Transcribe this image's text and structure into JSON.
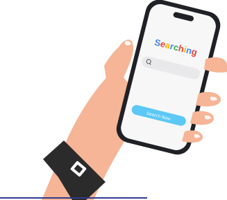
{
  "phone": {
    "title_letters": [
      {
        "char": "S",
        "color": "#4285F4"
      },
      {
        "char": "e",
        "color": "#EA4335"
      },
      {
        "char": "a",
        "color": "#FBBC05"
      },
      {
        "char": "r",
        "color": "#4285F4"
      },
      {
        "char": "c",
        "color": "#34A853"
      },
      {
        "char": "h",
        "color": "#EA4335"
      },
      {
        "char": "i",
        "color": "#FBBC05"
      },
      {
        "char": "n",
        "color": "#4285F4"
      },
      {
        "char": "g",
        "color": "#EA4335"
      }
    ],
    "search_button_label": "Search Now",
    "search_icon": "search-icon"
  },
  "colors": {
    "skin": "#F5B596",
    "skin_shadow": "#E99E7E",
    "phone_frame": "#1F2126",
    "screen": "#F7F7F7",
    "search_bar": "#E9E9EB",
    "button": "#5BC8F5",
    "watch_strap": "#2B2B2B",
    "bottom_line": "#2E3A8C"
  }
}
